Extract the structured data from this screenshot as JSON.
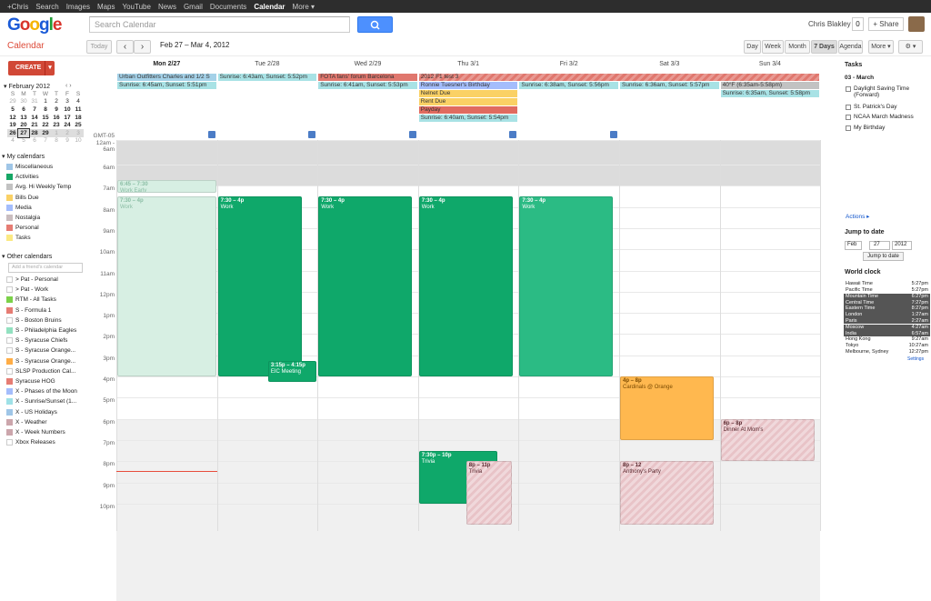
{
  "topbar": {
    "items": [
      "+Chris",
      "Search",
      "Images",
      "Maps",
      "YouTube",
      "News",
      "Gmail",
      "Documents",
      "Calendar",
      "More ▾"
    ],
    "active_index": 8
  },
  "header": {
    "logo": "Google",
    "search_placeholder": "Search Calendar",
    "user_name": "Chris Blakley",
    "notification_count": "0",
    "share_label": "+ Share"
  },
  "toolbar": {
    "app_title": "Calendar",
    "today_label": "Today",
    "prev_label": "‹",
    "next_label": "›",
    "date_range": "Feb 27 – Mar 4, 2012",
    "views": [
      "Day",
      "Week",
      "Month",
      "7 Days",
      "Agenda"
    ],
    "selected_view": "7 Days",
    "more_label": "More ▾",
    "settings_label": "⚙ ▾"
  },
  "sidebar": {
    "create_label": "CREATE",
    "create_dropdown": "▾",
    "mini_cal_title": "▾ February 2012",
    "mini_cal_nav": "‹ ›",
    "weekdays": [
      "S",
      "M",
      "T",
      "W",
      "T",
      "F",
      "S"
    ],
    "weeks": [
      [
        "29",
        "30",
        "31",
        "1",
        "2",
        "3",
        "4"
      ],
      [
        "5",
        "6",
        "7",
        "8",
        "9",
        "10",
        "11"
      ],
      [
        "12",
        "13",
        "14",
        "15",
        "16",
        "17",
        "18"
      ],
      [
        "19",
        "20",
        "21",
        "22",
        "23",
        "24",
        "25"
      ],
      [
        "26",
        "27",
        "28",
        "29",
        "1",
        "2",
        "3"
      ],
      [
        "4",
        "5",
        "6",
        "7",
        "8",
        "9",
        "10"
      ]
    ],
    "my_calendars_title": "▾ My calendars",
    "my_calendars": [
      {
        "label": "Miscellaneous",
        "color": "#9fc6e7"
      },
      {
        "label": "Activities",
        "color": "#16a765"
      },
      {
        "label": "Avg. Hi Weekly Temp",
        "color": "#c2c2c2"
      },
      {
        "label": "Bills Due",
        "color": "#fad165"
      },
      {
        "label": "Media",
        "color": "#a4bdfc"
      },
      {
        "label": "Nostalgia",
        "color": "#cabdbf"
      },
      {
        "label": "Personal",
        "color": "#e67c73"
      },
      {
        "label": "Tasks",
        "color": "#fbe983"
      }
    ],
    "other_calendars_title": "▾ Other calendars",
    "add_friend_placeholder": "Add a friend's calendar",
    "other_calendars": [
      {
        "label": "> Pat - Personal",
        "color": ""
      },
      {
        "label": "> Pat - Work",
        "color": ""
      },
      {
        "label": "RTM - All Tasks",
        "color": "#7bd148"
      },
      {
        "label": "S - Formula 1",
        "color": "#e67c73"
      },
      {
        "label": "S - Boston Bruins",
        "color": ""
      },
      {
        "label": "S - Philadelphia Eagles",
        "color": "#92e1c0"
      },
      {
        "label": "S - Syracuse Chiefs",
        "color": ""
      },
      {
        "label": "S - Syracuse Orange...",
        "color": ""
      },
      {
        "label": "S - Syracuse Orange...",
        "color": "#ffad46"
      },
      {
        "label": "SLSP Production Cal...",
        "color": ""
      },
      {
        "label": "Syracuse HOG",
        "color": "#e67c73"
      },
      {
        "label": "X - Phases of the Moon",
        "color": "#a4bdfc"
      },
      {
        "label": "X - Sunrise/Sunset (1...",
        "color": "#9fe1e7"
      },
      {
        "label": "X - US Holidays",
        "color": "#9fc6e7"
      },
      {
        "label": "X - Weather",
        "color": "#cca6ac"
      },
      {
        "label": "X - Week Numbers",
        "color": "#cca6ac"
      },
      {
        "label": "Xbox Releases",
        "color": ""
      }
    ]
  },
  "week": {
    "timezone": "GMT-05",
    "days": [
      "Mon 2/27",
      "Tue 2/28",
      "Wed 2/29",
      "Thu 3/1",
      "Fri 3/2",
      "Sat 3/3",
      "Sun 3/4"
    ],
    "selected_day": 0,
    "hours": [
      "12am - 6am",
      "6am",
      "7am",
      "8am",
      "9am",
      "10am",
      "11am",
      "12pm",
      "1pm",
      "2pm",
      "3pm",
      "4pm",
      "5pm",
      "6pm",
      "7pm",
      "8pm",
      "9pm",
      "10pm"
    ]
  },
  "allday_events": [
    {
      "day": 0,
      "span": 1,
      "row": 0,
      "text": "Urban Outfitters Charles and 1/2 S",
      "color": "#a4d1e8"
    },
    {
      "day": 0,
      "span": 1,
      "row": 1,
      "text": "Sunrise: 6:45am, Sunset: 5:51pm",
      "color": "#a8e2e5"
    },
    {
      "day": 1,
      "span": 1,
      "row": 0,
      "text": "Sunrise: 6:43am, Sunset: 5:52pm",
      "color": "#a8e2e5"
    },
    {
      "day": 2,
      "span": 1,
      "row": 0,
      "text": "FOTA fans' forum Barcelona",
      "color": "#e0776e"
    },
    {
      "day": 2,
      "span": 1,
      "row": 1,
      "text": "Sunrise: 6:41am, Sunset: 5:53pm",
      "color": "#a8e2e5"
    },
    {
      "day": 3,
      "span": 4,
      "row": 0,
      "text": "2012 F1 test 3",
      "color": "#e0776e"
    },
    {
      "day": 3,
      "span": 1,
      "row": 1,
      "text": "Ronnie Tuesner's Birthday",
      "color": "#a4bdfc"
    },
    {
      "day": 3,
      "span": 1,
      "row": 2,
      "text": "Nelnet Due",
      "color": "#fad165"
    },
    {
      "day": 3,
      "span": 1,
      "row": 3,
      "text": "Rent Due",
      "color": "#fad165"
    },
    {
      "day": 3,
      "span": 1,
      "row": 4,
      "text": "Payday",
      "color": "#e06b60"
    },
    {
      "day": 3,
      "span": 1,
      "row": 5,
      "text": "Sunrise: 6:40am, Sunset: 5:54pm",
      "color": "#a8e2e5"
    },
    {
      "day": 4,
      "span": 1,
      "row": 1,
      "text": "Sunrise: 6:38am, Sunset: 5:56pm",
      "color": "#a8e2e5"
    },
    {
      "day": 5,
      "span": 1,
      "row": 1,
      "text": "Sunrise: 6:36am, Sunset: 5:57pm",
      "color": "#a8e2e5"
    },
    {
      "day": 6,
      "span": 1,
      "row": 1,
      "text": "40°F (6:35am-5:58pm)",
      "color": "#c2c2c2"
    },
    {
      "day": 6,
      "span": 1,
      "row": 2,
      "text": "Sunrise: 6:35am, Sunset: 5:58pm",
      "color": "#a8e2e5"
    }
  ],
  "timed_events": [
    {
      "day": 0,
      "start": 6.75,
      "end": 7.33,
      "time": "6:45 – 7:30",
      "title": "Work Early",
      "color": "#d7efe3",
      "text_color": "#8abda4",
      "left": 0,
      "width": 1
    },
    {
      "day": 0,
      "start": 7.5,
      "end": 16,
      "time": "7:30 – 4p",
      "title": "Work",
      "color": "#d7efe3",
      "text_color": "#8abda4",
      "left": 0,
      "width": 1
    },
    {
      "day": 1,
      "start": 7.5,
      "end": 16,
      "time": "7:30 – 4p",
      "title": "Work",
      "color": "#0fa86a",
      "text_color": "#ffffff",
      "left": 0,
      "width": 0.85
    },
    {
      "day": 1,
      "start": 15.25,
      "end": 16.25,
      "time": "3:15p – 4:15p",
      "title": "EIC Meeting",
      "color": "#0fa86a",
      "text_color": "#ffffff",
      "left": 0.5,
      "width": 0.5
    },
    {
      "day": 2,
      "start": 7.5,
      "end": 16,
      "time": "7:30 – 4p",
      "title": "Work",
      "color": "#0fa86a",
      "text_color": "#ffffff",
      "left": 0,
      "width": 0.95
    },
    {
      "day": 3,
      "start": 7.5,
      "end": 16,
      "time": "7:30 – 4p",
      "title": "Work",
      "color": "#0fa86a",
      "text_color": "#ffffff",
      "left": 0,
      "width": 0.95
    },
    {
      "day": 4,
      "start": 7.5,
      "end": 16,
      "time": "7:30 – 4p",
      "title": "Work",
      "color": "#2bbb84",
      "text_color": "#ffffff",
      "left": 0,
      "width": 0.95
    },
    {
      "day": 5,
      "start": 16,
      "end": 19,
      "time": "4p – 8p",
      "title": "Cardinals @ Orange",
      "color": "#ffb84f",
      "text_color": "#7a4a00",
      "left": 0,
      "width": 0.95
    },
    {
      "day": 6,
      "start": 18,
      "end": 20,
      "time": "6p – 8p",
      "title": "Dinner At Mom's",
      "color": "#e8c3c7",
      "text_color": "#5a2a30",
      "left": 0,
      "width": 0.95
    },
    {
      "day": 3,
      "start": 19.5,
      "end": 22,
      "time": "7:30p – 10p",
      "title": "Trivia",
      "color": "#0fa86a",
      "text_color": "#ffffff",
      "left": 0,
      "width": 0.8
    },
    {
      "day": 3,
      "start": 20,
      "end": 23,
      "time": "8p – 11p",
      "title": "Trivia",
      "color": "#e8c3c7",
      "text_color": "#5a2a30",
      "left": 0.47,
      "width": 0.47
    },
    {
      "day": 5,
      "start": 20,
      "end": 24,
      "time": "8p – 12",
      "title": "Anthony's Party",
      "color": "#e8c3c7",
      "text_color": "#5a2a30",
      "left": 0,
      "width": 0.95
    }
  ],
  "right": {
    "tasks_title": "Tasks",
    "tasks_date": "03 - March",
    "tasks": [
      "Daylight Saving Time (Forward)",
      "St. Patrick's Day",
      "NCAA March Madness",
      "My Birthday"
    ],
    "actions_label": "Actions ▸",
    "jump_title": "Jump to date",
    "jump_month": "Feb",
    "jump_day": "27",
    "jump_year": "2012",
    "jump_btn": "Jump to date",
    "world_title": "World clock",
    "clocks": [
      {
        "city": "Hawaii Time",
        "time": "5:27pm",
        "dark": false
      },
      {
        "city": "Pacific Time",
        "time": "5:27pm",
        "dark": false
      },
      {
        "city": "Mountain Time",
        "time": "6:27pm",
        "dark": true
      },
      {
        "city": "Central Time",
        "time": "7:27pm",
        "dark": true
      },
      {
        "city": "Eastern Time",
        "time": "8:27pm",
        "dark": true
      },
      {
        "city": "London",
        "time": "1:27am",
        "dark": true
      },
      {
        "city": "Paris",
        "time": "2:27am",
        "dark": true
      },
      {
        "city": "Moscow",
        "time": "4:27am",
        "dark": true
      },
      {
        "city": "India",
        "time": "6:57am",
        "dark": true
      },
      {
        "city": "Hong Kong",
        "time": "9:27am",
        "dark": false
      },
      {
        "city": "Tokyo",
        "time": "10:27am",
        "dark": false
      },
      {
        "city": "Melbourne, Sydney",
        "time": "12:27pm",
        "dark": false
      }
    ],
    "settings_link": "Settings"
  }
}
